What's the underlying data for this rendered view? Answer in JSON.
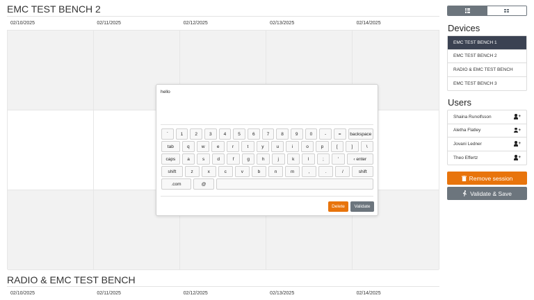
{
  "benches": [
    {
      "title": "EMC TEST BENCH 2",
      "dates": [
        "02/10/2025",
        "02/11/2025",
        "02/12/2025",
        "02/13/2025",
        "02/14/2025"
      ]
    },
    {
      "title": "RADIO & EMC TEST BENCH",
      "dates": [
        "02/10/2025",
        "02/11/2025",
        "02/12/2025",
        "02/13/2025",
        "02/14/2025"
      ]
    }
  ],
  "view_toggle": {
    "active": "list-view",
    "icons": [
      "list-icon",
      "grid-icon"
    ]
  },
  "devices": {
    "title": "Devices",
    "items": [
      "EMC TEST BENCH 1",
      "EMC TEST BENCH 2",
      "RADIO & EMC TEST BENCH",
      "EMC TEST BENCH 3"
    ],
    "selected_index": 0
  },
  "users": {
    "title": "Users",
    "items": [
      "Shaina Runolfsson",
      "Aletha Flatley",
      "Jovani Ledner",
      "Theo Effertz"
    ]
  },
  "actions": {
    "remove_label": "Remove session",
    "save_label": "Validate & Save"
  },
  "keyboard_modal": {
    "text": "hello",
    "rows": [
      [
        "`",
        "1",
        "2",
        "3",
        "4",
        "5",
        "6",
        "7",
        "8",
        "9",
        "0",
        "-",
        "=",
        "backspace"
      ],
      [
        "tab",
        "q",
        "w",
        "e",
        "r",
        "t",
        "y",
        "u",
        "i",
        "o",
        "p",
        "[",
        "]",
        "\\"
      ],
      [
        "caps",
        "a",
        "s",
        "d",
        "f",
        "g",
        "h",
        "j",
        "k",
        "l",
        ";",
        "'",
        "‹ enter"
      ],
      [
        "shift",
        "z",
        "x",
        "c",
        "v",
        "b",
        "n",
        "m",
        ",",
        ".",
        "/",
        "shift"
      ],
      [
        ".com",
        "@",
        " "
      ]
    ],
    "delete_label": "Delete",
    "validate_label": "Validate"
  },
  "colors": {
    "accent_orange": "#e8740c",
    "secondary_gray": "#6c757d",
    "selected_dark": "#3b4252"
  }
}
